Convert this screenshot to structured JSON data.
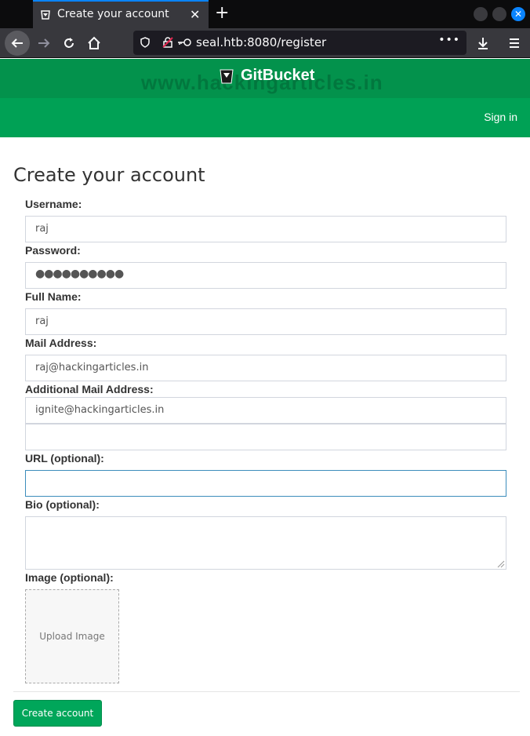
{
  "browser": {
    "tab_title": "Create your account",
    "tab_close": "✕",
    "new_tab": "+",
    "url": "seal.htb:8080/register",
    "url_more": "•••",
    "window_close": "✕"
  },
  "header": {
    "brand": "GitBucket",
    "watermark": "www.hackingarticles.in",
    "signin": "Sign in"
  },
  "form": {
    "title": "Create your account",
    "username_label": "Username:",
    "username_value": "raj",
    "password_label": "Password:",
    "password_value": "●●●●●●●●●●",
    "fullname_label": "Full Name:",
    "fullname_value": "raj",
    "mail_label": "Mail Address:",
    "mail_value": "raj@hackingarticles.in",
    "additional_mail_label": "Additional Mail Address:",
    "additional_mail_values": [
      "ignite@hackingarticles.in",
      ""
    ],
    "url_label": "URL (optional):",
    "url_value": "",
    "bio_label": "Bio (optional):",
    "bio_value": "",
    "image_label": "Image (optional):",
    "upload_text": "Upload Image",
    "submit_label": "Create account"
  },
  "colors": {
    "header_dark": "#03924c",
    "header_light": "#00a155",
    "button": "#00a65a",
    "focus_border": "#3c8dbc"
  }
}
